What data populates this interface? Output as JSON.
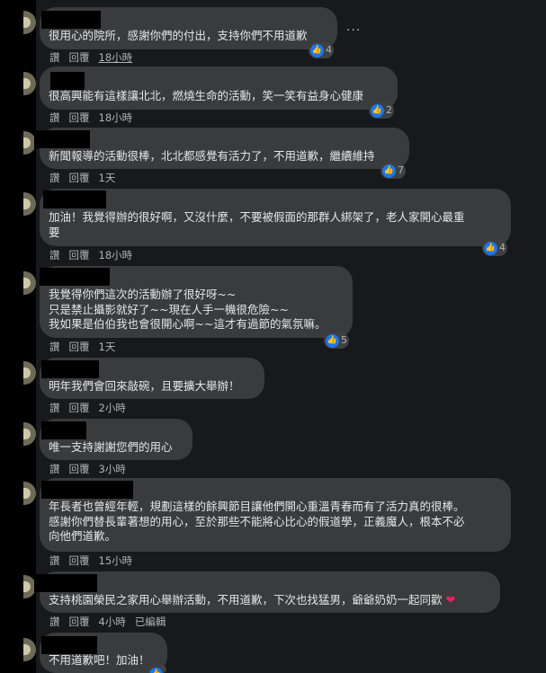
{
  "actions": {
    "like": "讚",
    "reply": "回覆",
    "edited": "已編輯"
  },
  "more_label": "···",
  "comments": [
    {
      "text": "很用心的院所，感謝你們的付出，支持你們不用道歉",
      "time": "18小時",
      "reactions": "4"
    },
    {
      "text": "很高興能有這樣讓北北，燃燒生命的活動，笑一笑有益身心健康",
      "time": "18小時",
      "reactions": "2"
    },
    {
      "text": "新聞報導的活動很棒，北北都感覺有活力了，不用道歉，繼續維持",
      "time": "1天",
      "reactions": "7"
    },
    {
      "text": "加油！我覺得辦的很好啊，又沒什麼，不要被假面的那群人綁架了，老人家開心最重\n要",
      "time": "18小時",
      "reactions": "4"
    },
    {
      "text": "我覺得你們這次的活動辦了很好呀~~\n只是禁止攝影就好了~~現在人手一機很危險~~\n我如果是伯伯我也會很開心啊~~這才有過節的氣氛嘛。",
      "time": "1天",
      "reactions": "5"
    },
    {
      "text": "明年我們會回來敲碗，且要擴大舉辦！",
      "time": "2小時",
      "reactions": ""
    },
    {
      "text": "唯一支持謝謝您們的用心",
      "time": "3小時",
      "reactions": ""
    },
    {
      "text": "年長者也曾經年輕，規劃這樣的餘興節目讓他們開心重溫青春而有了活力真的很棒。\n感謝你們替長輩著想的用心，至於那些不能將心比心的假道學，正義魔人，根本不必\n向他們道歉。",
      "time": "15小時",
      "reactions": ""
    },
    {
      "text": "支持桃園榮民之家用心舉辦活動，不用道歉，下次也找猛男，爺爺奶奶一起同歡",
      "time": "4小時",
      "reactions": ""
    },
    {
      "text": "不用道歉吧！加油！",
      "time": "",
      "reactions": ""
    }
  ]
}
